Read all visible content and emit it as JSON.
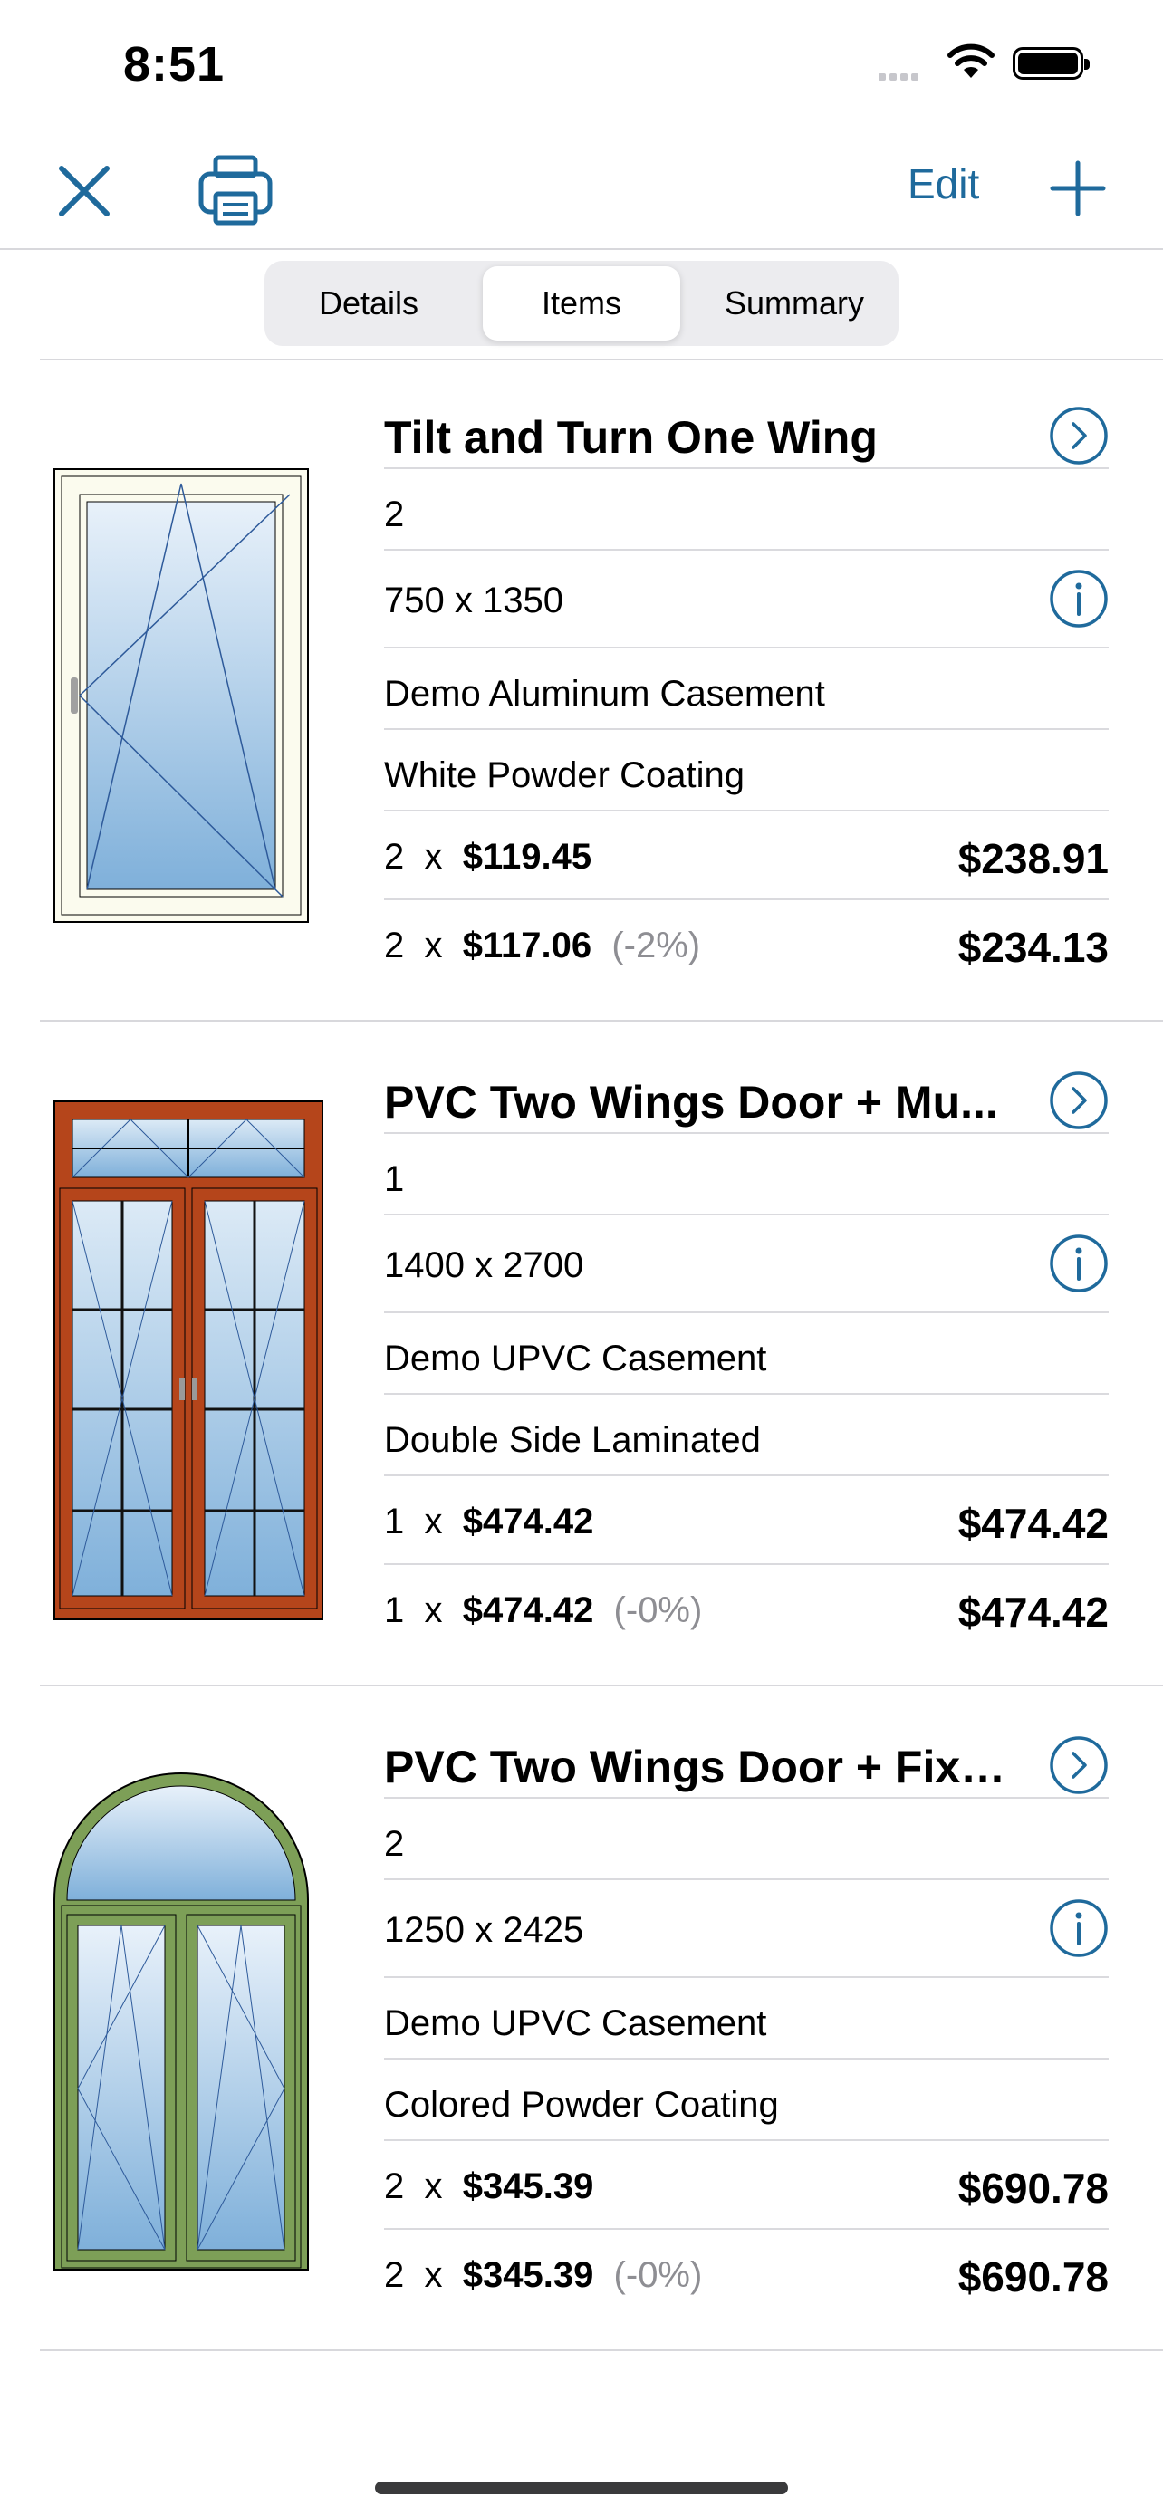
{
  "status": {
    "time": "8:51"
  },
  "nav": {
    "edit_label": "Edit"
  },
  "segments": [
    "Details",
    "Items",
    "Summary"
  ],
  "selected_segment": "Items",
  "items": [
    {
      "title": "Tilt and Turn One Wing",
      "qty": "2",
      "size": "750 x 1350",
      "series": "Demo Aluminum Casement",
      "finish": "White Powder Coating",
      "price_row": {
        "qty": "2",
        "x": "x",
        "unit": "$119.45",
        "total": "$238.91"
      },
      "discount_row": {
        "qty": "2",
        "x": "x",
        "unit": "$117.06",
        "pct": "(-2%)",
        "total": "$234.13"
      }
    },
    {
      "title": "PVC Two Wings Door + Mu...",
      "qty": "1",
      "size": "1400 x 2700",
      "series": "Demo UPVC Casement",
      "finish": "Double Side Laminated",
      "price_row": {
        "qty": "1",
        "x": "x",
        "unit": "$474.42",
        "total": "$474.42"
      },
      "discount_row": {
        "qty": "1",
        "x": "x",
        "unit": "$474.42",
        "pct": "(-0%)",
        "total": "$474.42"
      }
    },
    {
      "title": "PVC Two Wings Door + Fixe...",
      "qty": "2",
      "size": "1250 x 2425",
      "series": "Demo UPVC Casement",
      "finish": "Colored Powder Coating",
      "price_row": {
        "qty": "2",
        "x": "x",
        "unit": "$345.39",
        "total": "$690.78"
      },
      "discount_row": {
        "qty": "2",
        "x": "x",
        "unit": "$345.39",
        "pct": "(-0%)",
        "total": "$690.78"
      }
    }
  ],
  "colors": {
    "accent": "#1f6a9c",
    "glass": "#9cc3e6",
    "frame_wood": "#b5451b",
    "frame_green": "#7d9f57",
    "frame_white": "#fbfbee"
  }
}
